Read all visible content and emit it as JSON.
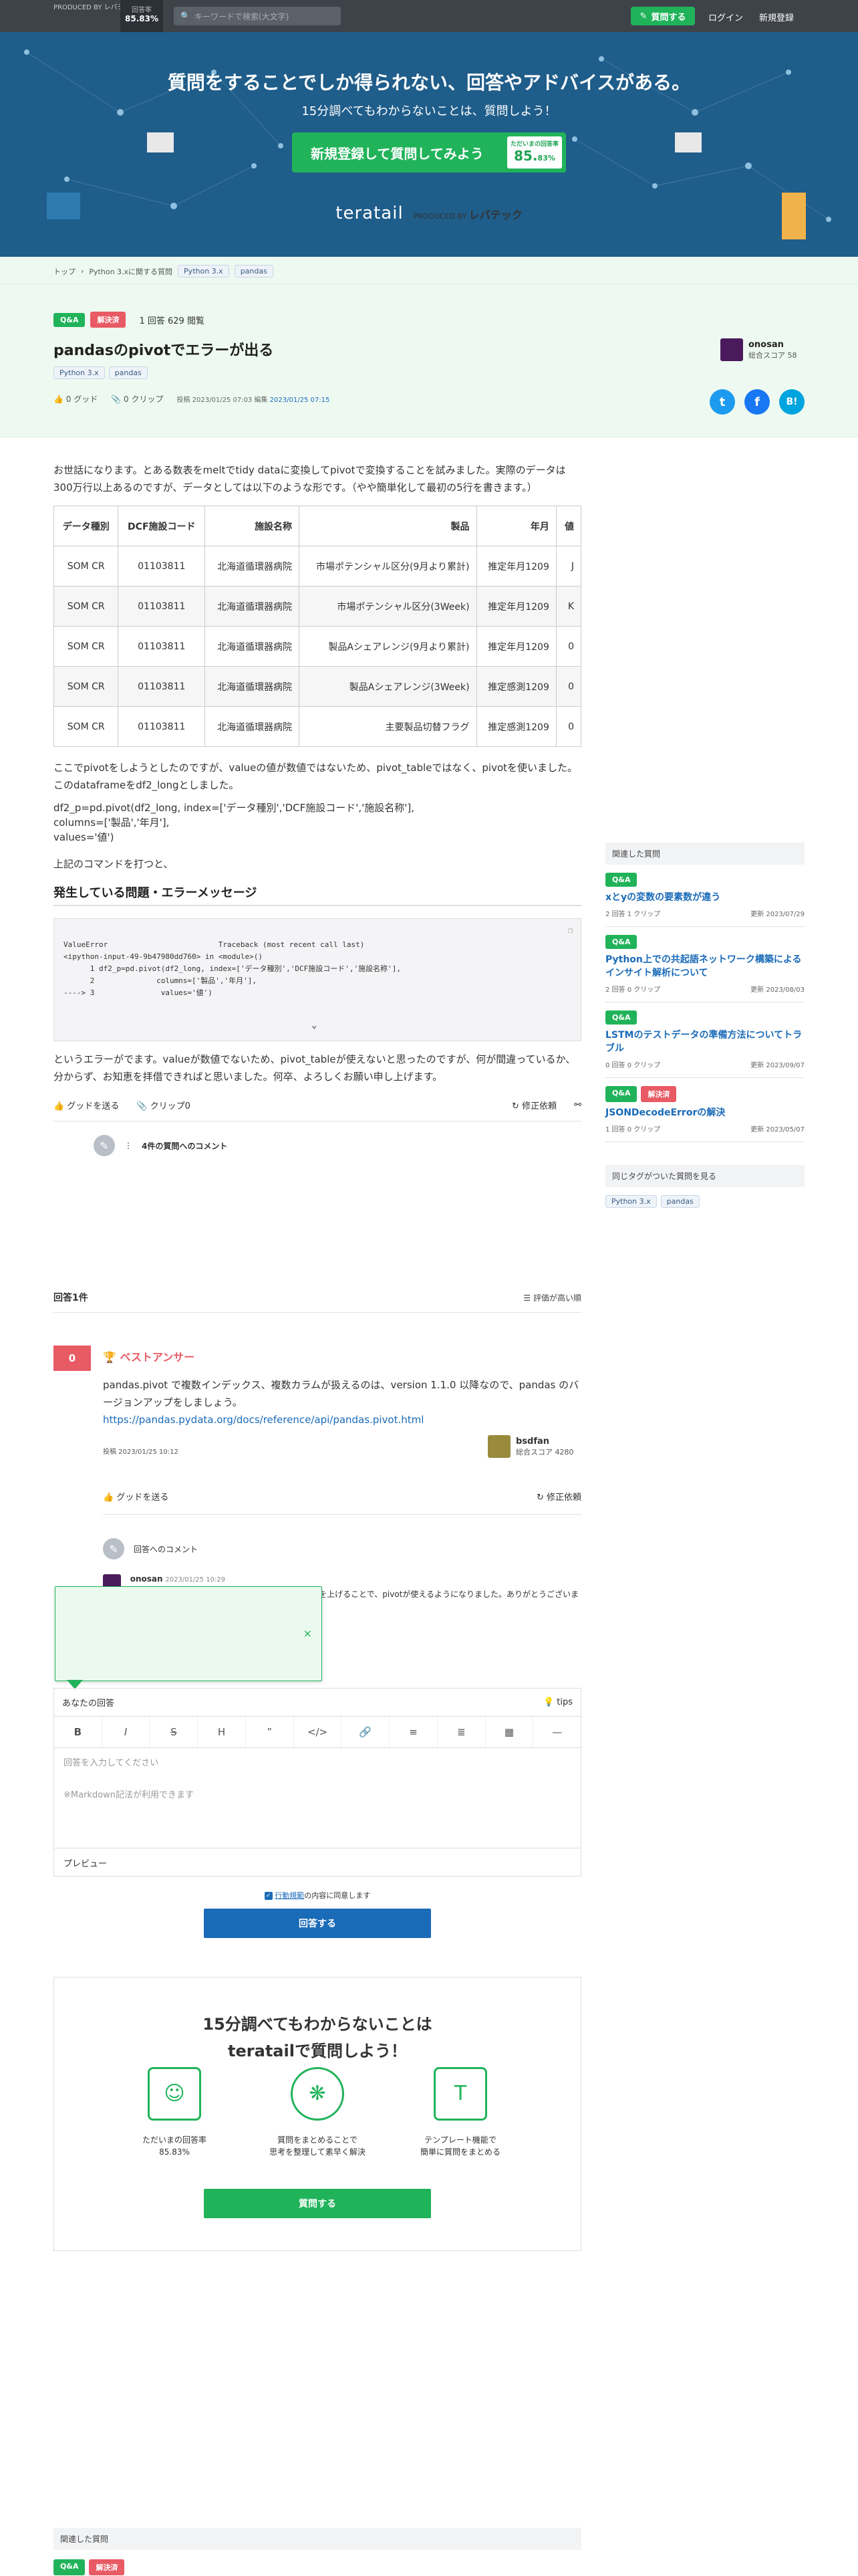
{
  "header": {
    "logo": "teratail",
    "logo_sub": "PRODUCED BY レバテック",
    "rate_label": "回答率",
    "rate_value": "85.83%",
    "search_placeholder": "キーワードで検索(大文字)",
    "ask_button": "質問する",
    "login": "ログイン",
    "register": "新規登録"
  },
  "hero": {
    "headline": "質問をすることでしか得られない、回答やアドバイスがある。",
    "subline": "15分調べてもわからないことは、質問しよう！",
    "cta": "新規登録して質問してみよう",
    "badge_label": "ただいまの回答率",
    "badge_value": "85.",
    "badge_value_small": "83%",
    "footer_logo": "teratail",
    "footer_produced": "PRODUCED BY",
    "footer_brand": "レバテック"
  },
  "breadcrumb": {
    "items": [
      "トップ",
      "Python 3.xに関する質問"
    ],
    "tags": [
      "Python 3.x",
      "pandas"
    ]
  },
  "question": {
    "status_qa": "Q&A",
    "status_solved": "解決済",
    "stats": "1 回答  629 閲覧",
    "title": "pandasのpivotでエラーが出る",
    "tags": [
      "Python 3.x",
      "pandas"
    ],
    "good": "0 グッド",
    "clip": "0 クリップ",
    "posted_label": "投稿",
    "posted": "2023/01/25 07:03",
    "edited_label": "編集",
    "edited": "2023/01/25 07:15",
    "author_name": "onosan",
    "author_score": "総合スコア 58"
  },
  "share": {
    "twitter": "t",
    "facebook": "f",
    "hatena": "B!",
    "colors": {
      "twitter": "#1d9bf0",
      "facebook": "#1877f2",
      "hatena": "#00a4de"
    }
  },
  "body": {
    "intro": "お世話になります。とある数表をmeltでtidy dataに変換してpivotで変換することを試みました。実際のデータは300万行以上あるのですが、データとしては以下のような形です。（やや簡単化して最初の5行を書きます。）",
    "table": {
      "headers": [
        "データ種別",
        "DCF施設コード",
        "施設名称",
        "製品",
        "年月",
        "値"
      ],
      "rows": [
        [
          "SOM CR",
          "01103811",
          "北海道循環器病院",
          "市場ポテンシャル区分(9月より累計)",
          "推定年月1209",
          "J"
        ],
        [
          "SOM CR",
          "01103811",
          "北海道循環器病院",
          "市場ポテンシャル区分(3Week)",
          "推定年月1209",
          "K"
        ],
        [
          "SOM CR",
          "01103811",
          "北海道循環器病院",
          "製品Aシェアレンジ(9月より累計)",
          "推定年月1209",
          "0"
        ],
        [
          "SOM CR",
          "01103811",
          "北海道循環器病院",
          "製品Aシェアレンジ(3Week)",
          "推定感測1209",
          "0"
        ],
        [
          "SOM CR",
          "01103811",
          "北海道循環器病院",
          "主要製品切替フラグ",
          "推定感測1209",
          "0"
        ]
      ]
    },
    "para2": "ここでpivotをしようとしたのですが、valueの値が数値ではないため、pivot_tableではなく、pivotを使いました。このdataframeをdf2_longとしました。",
    "code_line1": "df2_p=pd.pivot(df2_long, index=['データ種別','DCF施設コード','施設名称'],",
    "code_line2": "columns=['製品','年月'],",
    "code_line3": "values='値')",
    "para3": "上記のコマンドを打つと、",
    "error_heading": "発生している問題・エラーメッセージ",
    "error_code": [
      "ValueError                         Traceback (most recent call last)",
      "<ipython-input-49-9b47980dd760> in <module>()",
      "      1 df2_p=pd.pivot(df2_long, index=['データ種別','DCF施設コード','施設名称'],",
      "      2              columns=['製品','年月'],",
      "----> 3               values='値')"
    ],
    "para4": "というエラーがでます。valueが数値でないため、pivot_tableが使えないと思ったのですが、何が間違っているか、分からず、お知恵を拝借できればと思いました。何卒、よろしくお願い申し上げます。",
    "good_btn": "グッドを送る",
    "clip_btn": "クリップ0",
    "edit_request": "修正依頼",
    "comments": "4件の質問へのコメント"
  },
  "sidebar": {
    "heading": "関連した質問",
    "items": [
      {
        "badges": [
          "Q&A"
        ],
        "title": "xとyの変数の要素数が違う",
        "answers": "2 回答",
        "clips": "1 クリップ",
        "updated": "更新 2023/07/29"
      },
      {
        "badges": [
          "Q&A"
        ],
        "title": "Python上での共起語ネットワーク構築によるインサイト解析について",
        "answers": "2 回答",
        "clips": "0 クリップ",
        "updated": "更新 2023/08/03"
      },
      {
        "badges": [
          "Q&A"
        ],
        "title": "LSTMのテストデータの準備方法についてトラブル",
        "answers": "0 回答",
        "clips": "0 クリップ",
        "updated": "更新 2023/09/07"
      },
      {
        "badges": [
          "Q&A",
          "解決済"
        ],
        "title": "JSONDecodeErrorの解決",
        "answers": "1 回答",
        "clips": "0 クリップ",
        "updated": "更新 2023/05/07"
      }
    ],
    "tags_heading": "同じタグがついた質問を見る",
    "tags": [
      "Python 3.x",
      "pandas"
    ]
  },
  "answers": {
    "count": "回答1件",
    "sort": "評価が高い順",
    "vote": "0",
    "best": "ベストアンサー",
    "text": "pandas.pivot で複数インデックス、複数カラムが扱えるのは、version 1.1.0 以降なので、pandas のバージョンアップをしましょう。",
    "link": "https://pandas.pydata.org/docs/reference/api/pandas.pivot.html",
    "posted": "投稿 2023/01/25 10:12",
    "author": "bsdfan",
    "author_score": "総合スコア 4280",
    "good_btn": "グッドを送る",
    "edit_request": "修正依頼",
    "comment_heading": "回答へのコメント",
    "commenter": "onosan",
    "comment_date": "2023/01/25 10:29",
    "comment_text": "ご回答ありがとうございます。pandasのバージョンを上げることで、pivotが使えるようになりました。ありがとうございました。"
  },
  "editor": {
    "label": "あなたの回答",
    "tips": "tips",
    "placeholder": "回答を入力してください",
    "markdown_note": "※Markdown記法が利用できます",
    "preview": "プレビュー",
    "agree_link": "行動規範",
    "agree_text": "の内容に同意します",
    "submit": "回答する"
  },
  "promo": {
    "title_line1": "15分調べてもわからないことは",
    "title_line2": "teratailで質問しよう！",
    "features": [
      {
        "line1": "ただいまの回答率",
        "line2": "85.83%"
      },
      {
        "line1": "質問をまとめることで",
        "line2": "思考を整理して素早く解決"
      },
      {
        "line1": "テンプレート機能で",
        "line2": "簡単に質問をまとめる"
      }
    ],
    "button": "質問する"
  },
  "bottom_related": {
    "heading": "関連した質問",
    "badges": [
      "Q&A",
      "解決済"
    ]
  }
}
